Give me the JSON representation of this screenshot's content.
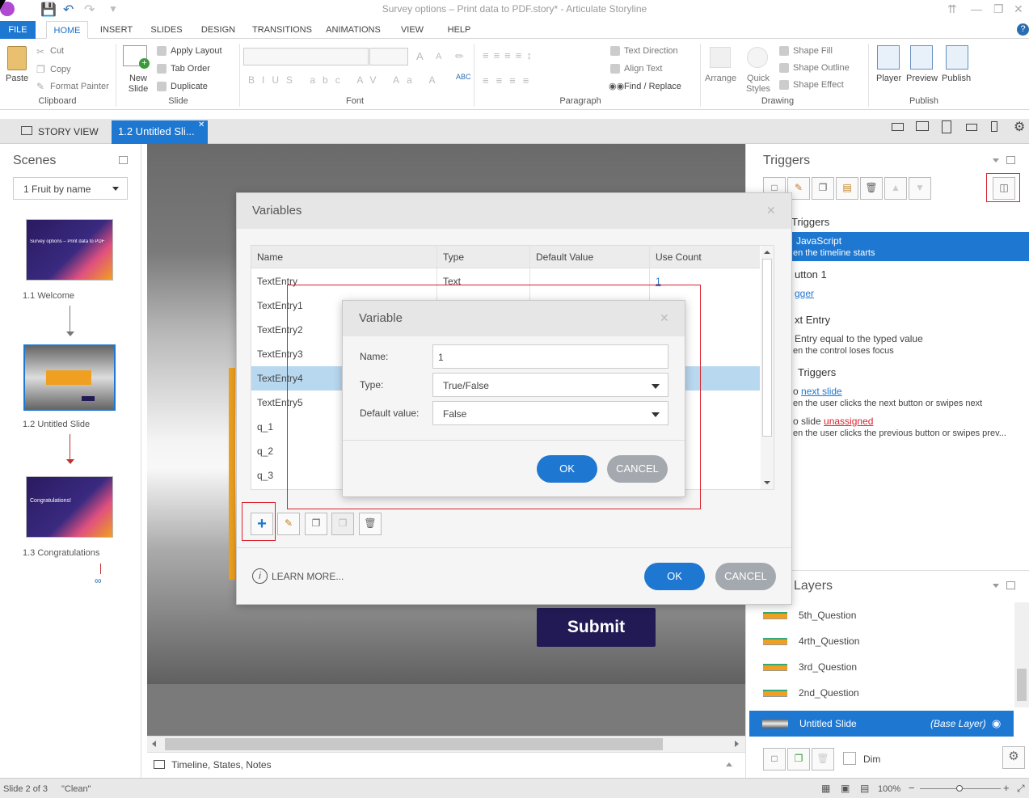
{
  "window": {
    "title": "Survey options – Print data to PDF.story* - Articulate Storyline"
  },
  "menu_tabs": [
    "FILE",
    "HOME",
    "INSERT",
    "SLIDES",
    "DESIGN",
    "TRANSITIONS",
    "ANIMATIONS",
    "VIEW",
    "HELP"
  ],
  "ribbon": {
    "clipboard": {
      "label": "Clipboard",
      "paste": "Paste",
      "cut": "Cut",
      "copy": "Copy",
      "format_painter": "Format Painter"
    },
    "slide": {
      "label": "Slide",
      "new_slide": "New Slide",
      "apply_layout": "Apply Layout",
      "tab_order": "Tab Order",
      "duplicate": "Duplicate"
    },
    "font": {
      "label": "Font"
    },
    "paragraph": {
      "label": "Paragraph",
      "text_direction": "Text Direction",
      "align_text": "Align Text",
      "find_replace": "Find / Replace"
    },
    "drawing": {
      "label": "Drawing",
      "arrange": "Arrange",
      "quick_styles": "Quick Styles",
      "shape_fill": "Shape Fill",
      "shape_outline": "Shape Outline",
      "shape_effect": "Shape Effect"
    },
    "publish": {
      "label": "Publish",
      "player": "Player",
      "preview": "Preview",
      "publish": "Publish"
    }
  },
  "story_tabs": {
    "story_view": "STORY VIEW",
    "slide_tab": "1.2 Untitled Sli..."
  },
  "scenes": {
    "title": "Scenes",
    "dropdown": "1 Fruit by name",
    "slides": [
      {
        "label": "1.1 Welcome",
        "thumb_text": "Survey options – Print data to PDF"
      },
      {
        "label": "1.2 Untitled Slide"
      },
      {
        "label": "1.3 Congratulations",
        "thumb_text": "Congratulations!"
      }
    ]
  },
  "canvas": {
    "submit_label": "Submit",
    "timeline_label": "Timeline, States, Notes"
  },
  "variables_dialog": {
    "title": "Variables",
    "columns": [
      "Name",
      "Type",
      "Default Value",
      "Use Count"
    ],
    "rows": [
      {
        "name": "TextEntry",
        "type": "Text",
        "default": "",
        "count": "1"
      },
      {
        "name": "TextEntry1",
        "type": "",
        "default": "",
        "count": ""
      },
      {
        "name": "TextEntry2",
        "type": "",
        "default": "",
        "count": ""
      },
      {
        "name": "TextEntry3",
        "type": "",
        "default": "",
        "count": ""
      },
      {
        "name": "TextEntry4",
        "type": "",
        "default": "",
        "count": ""
      },
      {
        "name": "TextEntry5",
        "type": "",
        "default": "",
        "count": ""
      },
      {
        "name": "q_1",
        "type": "",
        "default": "",
        "count": ""
      },
      {
        "name": "q_2",
        "type": "",
        "default": "",
        "count": ""
      },
      {
        "name": "q_3",
        "type": "",
        "default": "",
        "count": ""
      }
    ],
    "selected_row": 4,
    "learn_more": "LEARN MORE...",
    "ok": "OK",
    "cancel": "CANCEL"
  },
  "variable_dialog": {
    "title": "Variable",
    "name_label": "Name:",
    "name_value": "1",
    "type_label": "Type:",
    "type_value": "True/False",
    "default_label": "Default value:",
    "default_value": "False",
    "ok": "OK",
    "cancel": "CANCEL"
  },
  "triggers": {
    "title": "Triggers",
    "slide_triggers": "Triggers",
    "js": "JavaScript",
    "js_when": "en the timeline starts",
    "button1": "utton 1",
    "button1_link": "gger",
    "text_entry": "xt Entry",
    "text_entry_1": "Entry equal to the typed value",
    "text_entry_2": "en the control loses focus",
    "player_triggers": "Triggers",
    "next_prefix": "o ",
    "next_link": "next slide",
    "next_when": "en the user clicks the next button or swipes next",
    "prev_prefix": "o slide ",
    "prev_link": "unassigned",
    "prev_when": "en the user clicks the previous button or swipes prev..."
  },
  "layers": {
    "title": "Layers",
    "items": [
      "5th_Question",
      "4rth_Question",
      "3rd_Question",
      "2nd_Question"
    ],
    "base": "Untitled Slide",
    "base_tag": "(Base Layer)",
    "dim": "Dim"
  },
  "status": {
    "slide": "Slide 2 of 3",
    "theme": "\"Clean\"",
    "zoom": "100%"
  },
  "colors": {
    "accent": "#1e78d2",
    "highlight": "#1e78d2",
    "selected_row": "#b8d8f0",
    "submit_bg": "#221a54",
    "red_outline": "#d9232e"
  }
}
